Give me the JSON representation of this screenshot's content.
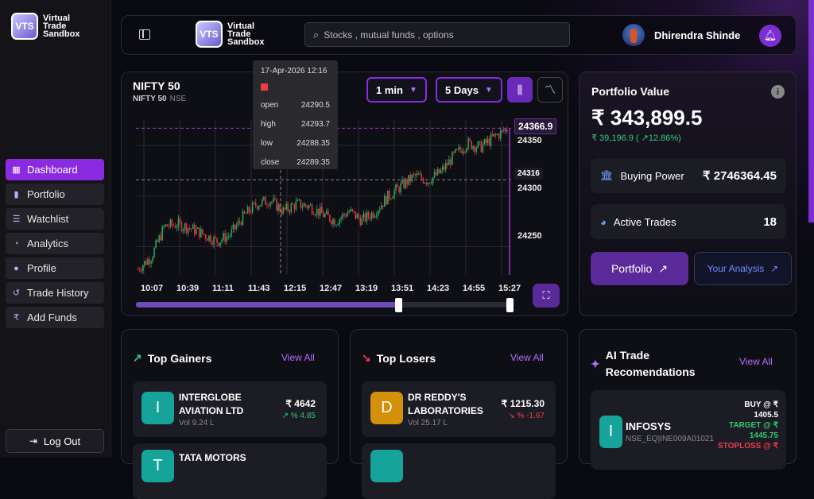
{
  "brand": {
    "logo_letters": "VTS",
    "name_line1": "Virtual",
    "name_line2": "Trade",
    "name_line3": "Sandbox"
  },
  "sidebar": {
    "items": [
      {
        "label": "Dashboard",
        "icon": "grid-icon",
        "active": true
      },
      {
        "label": "Portfolio",
        "icon": "bar-chart-icon",
        "active": false
      },
      {
        "label": "Watchlist",
        "icon": "list-icon",
        "active": false
      },
      {
        "label": "Analytics",
        "icon": "pie-chart-icon",
        "active": false
      },
      {
        "label": "Profile",
        "icon": "user-icon",
        "active": false
      },
      {
        "label": "Trade History",
        "icon": "history-icon",
        "active": false
      },
      {
        "label": "Add Funds",
        "icon": "rupee-icon",
        "active": false
      }
    ],
    "logout": "Log Out"
  },
  "topbar": {
    "search_placeholder": "Stocks , mutual funds , options",
    "user_name": "Dhirendra Shinde"
  },
  "chart": {
    "title": "NIFTY 50",
    "symbol": "NIFTY 50",
    "exchange": "NSE",
    "interval": "1 min",
    "range": "5 Days",
    "last_price": "24366.9",
    "crosshair_price": "24316",
    "y_ticks": [
      "24350",
      "24300",
      "24250"
    ],
    "x_ticks": [
      "10:07",
      "10:39",
      "11:11",
      "11:43",
      "12:15",
      "12:47",
      "13:19",
      "13:51",
      "14:23",
      "14:55",
      "15:27"
    ],
    "slider_position": 0.7,
    "tooltip": {
      "date": "17-Apr-2026 12:16",
      "open_label": "open",
      "open": "24290.5",
      "high_label": "high",
      "high": "24293.7",
      "low_label": "low",
      "low": "24288.35",
      "close_label": "close",
      "close": "24289.35"
    }
  },
  "chart_data": {
    "type": "candlestick",
    "ylim": [
      24222,
      24375
    ],
    "x_start": "10:07",
    "x_end": "15:27",
    "close_trend": [
      24228,
      24240,
      24270,
      24272,
      24268,
      24262,
      24255,
      24262,
      24280,
      24292,
      24296,
      24285,
      24292,
      24290,
      24282,
      24275,
      24285,
      24276,
      24285,
      24300,
      24310,
      24320,
      24315,
      24324,
      24340,
      24352,
      24348,
      24358,
      24366
    ]
  },
  "portfolio": {
    "title": "Portfolio Value",
    "value": "₹ 343,899.5",
    "change": "₹ 39,196.9  ( ↗12.86%)",
    "buying_power_label": "Buying Power",
    "buying_power": "₹ 2746364.45",
    "active_trades_label": "Active Trades",
    "active_trades": "18",
    "portfolio_button": "Portfolio",
    "analysis_button": "Your Analysis"
  },
  "gainers": {
    "title": "Top Gainers",
    "view_all": "View All",
    "items": [
      {
        "initial": "I",
        "name": "INTERGLOBE AVIATION LTD",
        "vol": "Vol 9.24 L",
        "price": "₹ 4642",
        "pct": "% 4.85"
      },
      {
        "initial": "T",
        "name": "TATA MOTORS",
        "vol": "",
        "price": "",
        "pct": ""
      }
    ]
  },
  "losers": {
    "title": "Top Losers",
    "view_all": "View All",
    "items": [
      {
        "initial": "D",
        "name": "DR REDDY'S LABORATORIES",
        "vol": "Vol 25.17 L",
        "price": "₹ 1215.30",
        "pct": "% -1.67"
      }
    ]
  },
  "ai": {
    "title_line1": "AI Trade",
    "title_line2": "Recomendations",
    "view_all": "View All",
    "item": {
      "initial": "I",
      "name": "INFOSYS",
      "code": "NSE_EQ|INE009A01021",
      "buy_label": "BUY @ ₹",
      "buy": "1405.5",
      "target_label": "TARGET @ ₹",
      "target": "1445.75",
      "stoploss_label": "STOPLOSS @ ₹"
    }
  },
  "colors": {
    "accent": "#8a2be2",
    "up": "#2ecc71",
    "down": "#ef3a4a"
  }
}
